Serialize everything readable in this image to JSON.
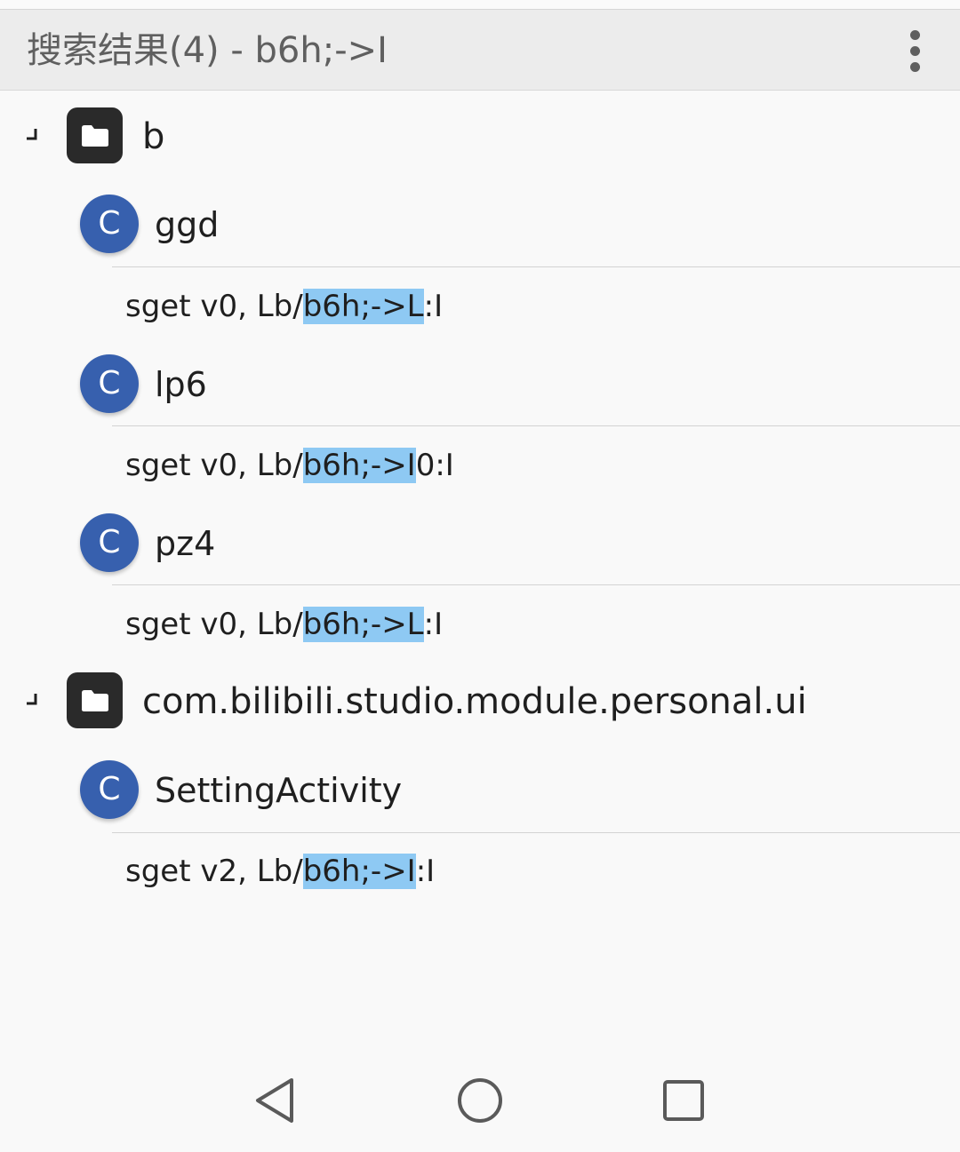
{
  "appbar": {
    "title": "搜索结果(4) - b6h;->I",
    "menu_icon": "more-vert-icon"
  },
  "groups": [
    {
      "package": "b",
      "classes": [
        {
          "name": "ggd",
          "icon_letter": "C",
          "result": {
            "pre": "sget v0, Lb/",
            "match": "b6h;->L",
            "post": ":I"
          }
        },
        {
          "name": "lp6",
          "icon_letter": "C",
          "result": {
            "pre": "sget v0, Lb/",
            "match": "b6h;->I",
            "post": "0:I"
          }
        },
        {
          "name": "pz4",
          "icon_letter": "C",
          "result": {
            "pre": "sget v0, Lb/",
            "match": "b6h;->L",
            "post": ":I"
          }
        }
      ]
    },
    {
      "package": "com.bilibili.studio.module.personal.ui",
      "classes": [
        {
          "name": "SettingActivity",
          "icon_letter": "C",
          "result": {
            "pre": "sget v2, Lb/",
            "match": "b6h;->I",
            "post": ":I"
          }
        }
      ]
    }
  ],
  "colors": {
    "highlight": "#8ec9f3",
    "class_icon_bg": "#3760ae",
    "folder_icon_bg": "#2a2a2a"
  },
  "navbar": {
    "back_icon": "back-triangle-icon",
    "home_icon": "home-circle-icon",
    "recents_icon": "recents-square-icon"
  }
}
